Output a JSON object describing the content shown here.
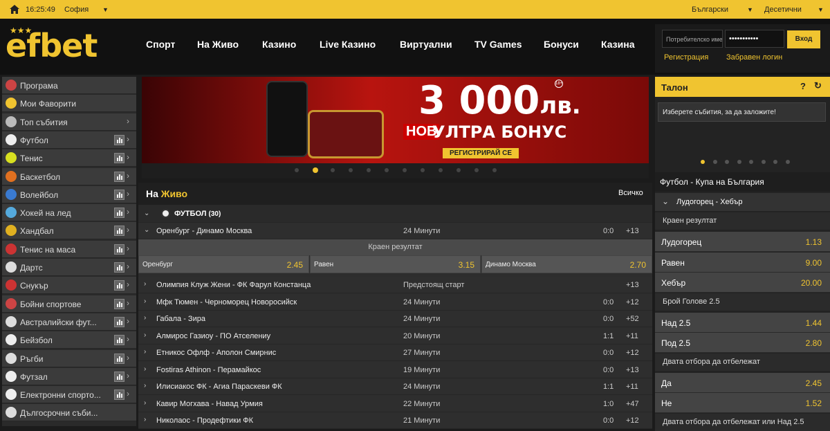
{
  "topbar": {
    "time": "16:25:49",
    "city": "София",
    "language": "Български",
    "odds_format": "Десетични"
  },
  "brand": {
    "logo": "efbet"
  },
  "nav": [
    "Спорт",
    "На Живо",
    "Казино",
    "Live Казино",
    "Виртуални",
    "TV Games",
    "Бонуси",
    "Казина"
  ],
  "login": {
    "username_placeholder": "Потребителско име",
    "password_mask": "•••••••••••",
    "login_button": "Вход",
    "register": "Регистрация",
    "forgot": "Забравен логин"
  },
  "sidebar": [
    {
      "label": "Програма",
      "icon": "calendar-icon",
      "color": "#c44"
    },
    {
      "label": "Мои Фаворити",
      "icon": "star-icon",
      "color": "#f0c430"
    },
    {
      "label": "Топ събития",
      "icon": "trophy-icon",
      "color": "#bbb"
    },
    {
      "label": "Футбол",
      "icon": "football-icon",
      "color": "#eee"
    },
    {
      "label": "Тенис",
      "icon": "tennis-icon",
      "color": "#d8e020"
    },
    {
      "label": "Баскетбол",
      "icon": "basketball-icon",
      "color": "#e07020"
    },
    {
      "label": "Волейбол",
      "icon": "volleyball-icon",
      "color": "#3a7ad0"
    },
    {
      "label": "Хокей на лед",
      "icon": "hockey-icon",
      "color": "#5ad"
    },
    {
      "label": "Хандбал",
      "icon": "handball-icon",
      "color": "#e0b020"
    },
    {
      "label": "Тенис на маса",
      "icon": "table-tennis-icon",
      "color": "#c33"
    },
    {
      "label": "Дартс",
      "icon": "darts-icon",
      "color": "#ddd"
    },
    {
      "label": "Снукър",
      "icon": "snooker-icon",
      "color": "#c33"
    },
    {
      "label": "Бойни спортове",
      "icon": "boxing-icon",
      "color": "#c44"
    },
    {
      "label": "Австралийски фут...",
      "icon": "aussie-rules-icon",
      "color": "#ddd"
    },
    {
      "label": "Бейзбол",
      "icon": "baseball-icon",
      "color": "#eee"
    },
    {
      "label": "Ръгби",
      "icon": "rugby-icon",
      "color": "#ddd"
    },
    {
      "label": "Футзал",
      "icon": "futsal-icon",
      "color": "#eee"
    },
    {
      "label": "Електронни спорто...",
      "icon": "gamepad-icon",
      "color": "#eee"
    },
    {
      "label": "Дългосрочни съби...",
      "icon": "longterm-icon",
      "color": "#ddd"
    }
  ],
  "banner": {
    "amount": "3 000",
    "currency": "лв.",
    "badge": "НОВ",
    "title": "УЛТРА БОНУС",
    "cta": "РЕГИСТРИРАЙ СЕ",
    "age": "18+"
  },
  "live": {
    "title_plain": "На",
    "title_accent": "Живо",
    "all": "Всичко",
    "sport": "ФУТБОЛ",
    "sport_count": "(30)",
    "market": "Краен резултат",
    "first": {
      "name": "Оренбург - Динамо Москва",
      "time": "24 Минути",
      "score": "0:0",
      "markets": "+13"
    },
    "odds": [
      {
        "label": "Оренбург",
        "value": "2.45"
      },
      {
        "label": "Равен",
        "value": "3.15"
      },
      {
        "label": "Динамо Москва",
        "value": "2.70"
      }
    ],
    "matches": [
      {
        "name": "Олимпия Клуж Жени - ФК Фарул Констанца",
        "time": "Предстоящ старт",
        "score": "",
        "markets": "+13"
      },
      {
        "name": "Мфк Тюмен - Черноморец Новоросийск",
        "time": "24 Минути",
        "score": "0:0",
        "markets": "+12"
      },
      {
        "name": "Габала - Зира",
        "time": "24 Минути",
        "score": "0:0",
        "markets": "+52"
      },
      {
        "name": "Алмирос Газиоу - ПО Атселениу",
        "time": "20 Минути",
        "score": "1:1",
        "markets": "+11"
      },
      {
        "name": "Етникос Офлф - Аполон Смирнис",
        "time": "27 Минути",
        "score": "0:0",
        "markets": "+12"
      },
      {
        "name": "Fostiras Athinon - Перамайкос",
        "time": "19 Минути",
        "score": "0:0",
        "markets": "+13"
      },
      {
        "name": "Илисиакос ФК - Агиа Параскеви ФК",
        "time": "24 Минути",
        "score": "1:1",
        "markets": "+11"
      },
      {
        "name": "Кавир Могхава - Навад Урмия",
        "time": "22 Минути",
        "score": "1:0",
        "markets": "+47"
      },
      {
        "name": "Николаос - Продефтики ФК",
        "time": "21 Минути",
        "score": "0:0",
        "markets": "+12"
      }
    ]
  },
  "betslip": {
    "title": "Талон",
    "help": "?",
    "empty_text": "Изберете събития, за да заложите!"
  },
  "featured": {
    "league": "Футбол - Купа на България",
    "event": "Лудогорец - Хебър",
    "sections": [
      {
        "title": "Краен резултат",
        "rows": [
          {
            "label": "Лудогорец",
            "value": "1.13"
          },
          {
            "label": "Равен",
            "value": "9.00"
          },
          {
            "label": "Хебър",
            "value": "20.00"
          }
        ]
      },
      {
        "title": "Брой Голове 2.5",
        "rows": [
          {
            "label": "Над 2.5",
            "value": "1.44"
          },
          {
            "label": "Под 2.5",
            "value": "2.80"
          }
        ]
      },
      {
        "title": "Двата отбора да отбележат",
        "rows": [
          {
            "label": "Да",
            "value": "2.45"
          },
          {
            "label": "Не",
            "value": "1.52"
          }
        ]
      },
      {
        "title": "Двата отбора да отбележат или Над 2.5",
        "rows": []
      }
    ]
  }
}
